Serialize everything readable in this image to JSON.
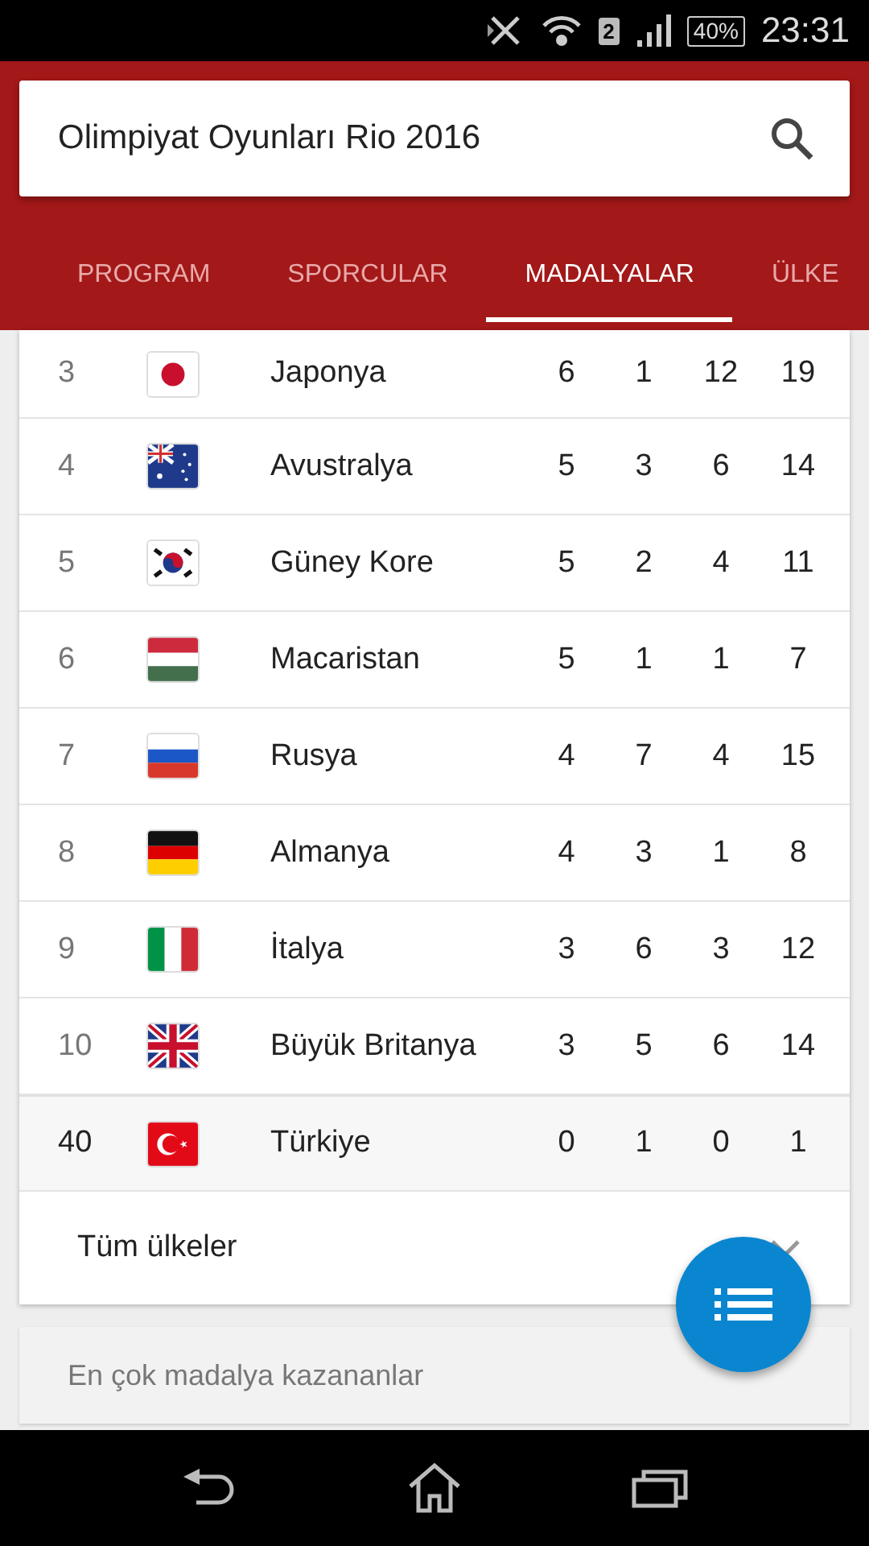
{
  "status_bar": {
    "sim": "2",
    "battery": "40%",
    "time": "23:31"
  },
  "search": {
    "value": "Olimpiyat Oyunları Rio 2016"
  },
  "tabs": [
    {
      "label": "PROGRAM",
      "selected": false
    },
    {
      "label": "SPORCULAR",
      "selected": false
    },
    {
      "label": "MADALYALAR",
      "selected": true
    },
    {
      "label": "ÜLKE",
      "selected": false
    }
  ],
  "medal_table": {
    "rows": [
      {
        "rank": "3",
        "kind": "jp",
        "country": "Japonya",
        "gold": "6",
        "silver": "1",
        "bronze": "12",
        "total": "19",
        "highlighted": false
      },
      {
        "rank": "4",
        "kind": "au",
        "country": "Avustralya",
        "gold": "5",
        "silver": "3",
        "bronze": "6",
        "total": "14",
        "highlighted": false
      },
      {
        "rank": "5",
        "kind": "kr",
        "country": "Güney Kore",
        "gold": "5",
        "silver": "2",
        "bronze": "4",
        "total": "11",
        "highlighted": false
      },
      {
        "rank": "6",
        "kind": "hu",
        "country": "Macaristan",
        "gold": "5",
        "silver": "1",
        "bronze": "1",
        "total": "7",
        "highlighted": false
      },
      {
        "rank": "7",
        "kind": "ru",
        "country": "Rusya",
        "gold": "4",
        "silver": "7",
        "bronze": "4",
        "total": "15",
        "highlighted": false
      },
      {
        "rank": "8",
        "kind": "de",
        "country": "Almanya",
        "gold": "4",
        "silver": "3",
        "bronze": "1",
        "total": "8",
        "highlighted": false
      },
      {
        "rank": "9",
        "kind": "it",
        "country": "İtalya",
        "gold": "3",
        "silver": "6",
        "bronze": "3",
        "total": "12",
        "highlighted": false
      },
      {
        "rank": "10",
        "kind": "gb",
        "country": "Büyük Britanya",
        "gold": "3",
        "silver": "5",
        "bronze": "6",
        "total": "14",
        "highlighted": false
      },
      {
        "rank": "40",
        "kind": "tr",
        "country": "Türkiye",
        "gold": "0",
        "silver": "1",
        "bronze": "0",
        "total": "1",
        "highlighted": true
      }
    ],
    "expand_label": "Tüm ülkeler"
  },
  "next_card": {
    "title": "En çok madalya kazananlar"
  }
}
